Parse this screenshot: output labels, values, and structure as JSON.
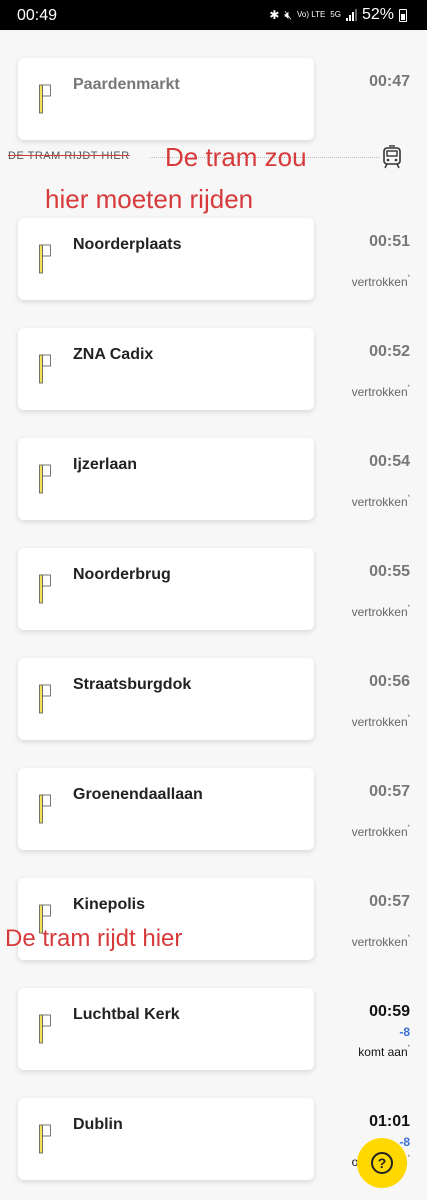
{
  "status": {
    "time": "00:49",
    "battery": "52%",
    "network": "5G",
    "volte": "Vo) LTE"
  },
  "tram_marker": {
    "label": "DE TRAM RIJDT HIER"
  },
  "annotations": {
    "line1": "De tram zou",
    "line2": "hier moeten rijden",
    "line3": "De tram rijdt hier"
  },
  "stops": [
    {
      "name": "Paardenmarkt",
      "time": "00:47",
      "delay": "",
      "state": ""
    },
    {
      "name": "Noorderplaats",
      "time": "00:51",
      "delay": "",
      "state": "vertrokken"
    },
    {
      "name": "ZNA Cadix",
      "time": "00:52",
      "delay": "",
      "state": "vertrokken"
    },
    {
      "name": "Ijzerlaan",
      "time": "00:54",
      "delay": "",
      "state": "vertrokken"
    },
    {
      "name": "Noorderbrug",
      "time": "00:55",
      "delay": "",
      "state": "vertrokken"
    },
    {
      "name": "Straatsburgdok",
      "time": "00:56",
      "delay": "",
      "state": "vertrokken"
    },
    {
      "name": "Groenendaallaan",
      "time": "00:57",
      "delay": "",
      "state": "vertrokken"
    },
    {
      "name": "Kinepolis",
      "time": "00:57",
      "delay": "",
      "state": "vertrokken"
    },
    {
      "name": "Luchtbal Kerk",
      "time": "00:59",
      "delay": "-8",
      "state": "komt aan"
    },
    {
      "name": "Dublin",
      "time": "01:01",
      "delay": "-8",
      "state": "over 3 min"
    }
  ],
  "help": {
    "icon": "question-icon"
  },
  "colors": {
    "accent": "#ffd800",
    "annotation": "#d73a3a",
    "delay": "#3a6fd8"
  }
}
